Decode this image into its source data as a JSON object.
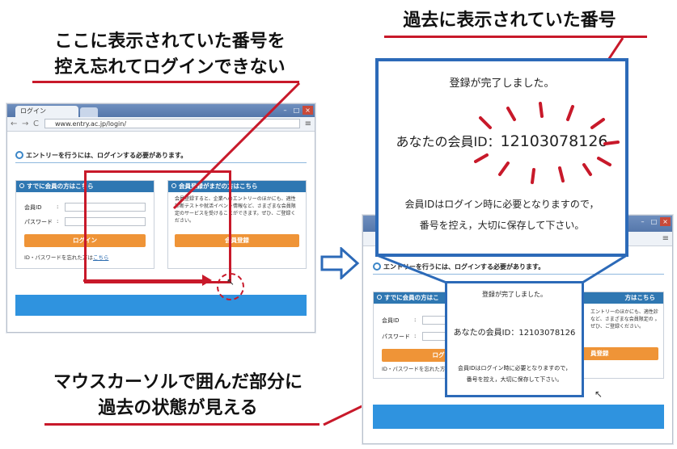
{
  "captions": {
    "left_top_line1": "ここに表示されていた番号を",
    "left_top_line2": "控え忘れてログインできない",
    "right_top": "過去に表示されていた番号",
    "bottom_line1": "マウスカーソルで囲んだ部分に",
    "bottom_line2": "過去の状態が見える"
  },
  "browser": {
    "tab_label": "ログイン",
    "url": "www.entry.ac.jp/login/",
    "win_min": "–",
    "win_max": "□",
    "win_close": "×",
    "back": "←",
    "forward": "→",
    "reload": "C",
    "menu": "≡"
  },
  "page": {
    "notice": "エントリーを行うには、ログインする必要があります。",
    "member_panel_title": "すでに会員の方はこちら",
    "member_id_label": "会員ID",
    "colon": ":",
    "password_label": "パスワード",
    "login_button": "ログイン",
    "forgot_text": "ID・パスワードを忘れた方は",
    "forgot_link": "こちら",
    "register_panel_title": "会員登録がまだの方はこちら",
    "register_text": "会員登録すると、企業へのエントリーのほかにも、適性診断テストや就活イベント情報など、さまざまな会員限定のサービスを受けることができます。ぜひ、ご登録ください。",
    "register_button": "会員登録"
  },
  "right_page": {
    "member_panel_title_partial": "すでに会員の方はこ",
    "register_panel_title_partial": "方はこちら",
    "login_button_partial": "ログ",
    "register_button_partial": "員登録",
    "register_text_partial": "エントリーのほかにも、適性診 など、さまざまな会員限定の 。ぜひ、ご登録ください。",
    "forgot_partial": "ID・パスワードを忘れた方は"
  },
  "big_popup": {
    "line1": "登録が完了しました。",
    "member_label": "あなたの会員ID：",
    "member_number": "12103078126",
    "note_line1": "会員IDはログイン時に必要となりますので，",
    "note_line2": "番号を控え，大切に保存して下さい。"
  },
  "small_popup": {
    "line1": "登録が完了しました。",
    "member_label": "あなたの会員ID：",
    "member_number": "12103078126",
    "note_line1": "会員IDはログイン時に必要となりますので，",
    "note_line2": "番号を控え，大切に保存して下さい。"
  },
  "colors": {
    "accent_blue": "#2f77b2",
    "bar_blue": "#2f93df",
    "orange": "#ef9437",
    "annotation_red": "#c8192a",
    "popup_border": "#2c6ab8"
  }
}
